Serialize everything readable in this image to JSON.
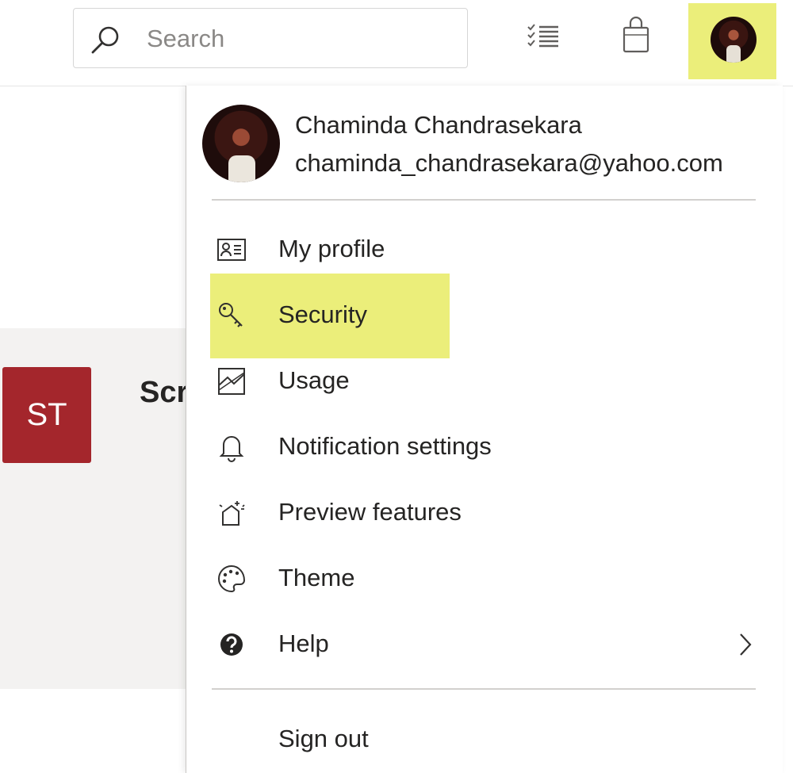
{
  "search": {
    "placeholder": "Search"
  },
  "header": {
    "icons": [
      "search-icon",
      "tasks-icon",
      "shopping-bag-icon",
      "avatar"
    ]
  },
  "background": {
    "site_tile_initials": "ST",
    "site_title_fragment": "Scr",
    "site_tile_color": "#a4262c"
  },
  "account": {
    "name": "Chaminda Chandrasekara",
    "email": "chaminda_chandrasekara@yahoo.com"
  },
  "menu": {
    "items": [
      {
        "label": "My profile",
        "icon": "contact-card-icon"
      },
      {
        "label": "Security",
        "icon": "key-icon",
        "highlighted": true
      },
      {
        "label": "Usage",
        "icon": "usage-icon"
      },
      {
        "label": "Notification settings",
        "icon": "bell-icon"
      },
      {
        "label": "Preview features",
        "icon": "preview-features-icon"
      },
      {
        "label": "Theme",
        "icon": "palette-icon"
      },
      {
        "label": "Help",
        "icon": "help-icon",
        "has_submenu": true
      }
    ],
    "sign_out_label": "Sign out"
  },
  "colors": {
    "highlight": "#ebee7a",
    "text": "#252423"
  }
}
